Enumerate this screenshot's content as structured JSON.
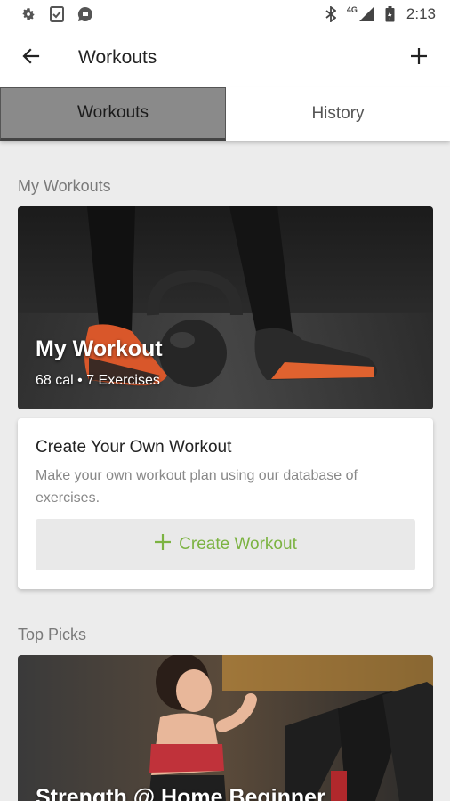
{
  "status_bar": {
    "icons_left": [
      "settings-icon",
      "clipboard-check-icon",
      "chat-bubble-icon"
    ],
    "icons_right": [
      "bluetooth-icon",
      "signal-icon",
      "battery-icon"
    ],
    "network": "4G",
    "time": "2:13"
  },
  "appbar": {
    "title": "Workouts",
    "back_icon": "arrow-left-icon",
    "add_icon": "plus-icon"
  },
  "tabs": [
    {
      "label": "Workouts",
      "active": true
    },
    {
      "label": "History",
      "active": false
    }
  ],
  "my_workouts": {
    "section_label": "My Workouts",
    "card": {
      "title": "My Workout",
      "meta": "68 cal • 7 Exercises"
    }
  },
  "create": {
    "heading": "Create Your Own Workout",
    "description": "Make your own workout plan using our database of exercises.",
    "button_label": "Create Workout",
    "button_icon": "plus-icon"
  },
  "top_picks": {
    "section_label": "Top Picks",
    "card": {
      "title": "Strength @ Home Beginner"
    }
  },
  "colors": {
    "accent_green": "#7cb342",
    "active_tab": "#8a8a8a",
    "background": "#ececec"
  }
}
